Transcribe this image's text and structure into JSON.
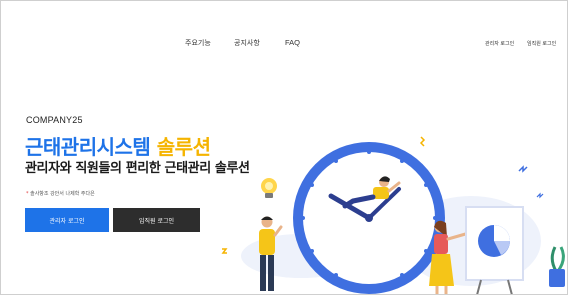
{
  "nav": {
    "items": [
      "주요기능",
      "공지사항",
      "FAQ"
    ],
    "admin_login": "관리자 로그인",
    "staff_login": "임직원 로그인"
  },
  "hero": {
    "brand": "COMPANY25",
    "title_main": "근태관리시스템",
    "title_accent": "솔루션",
    "subtitle": "관리자와 직원들의 편리한 근태관리 솔루션",
    "note_marker": "*",
    "note": "솔사항조 강안서 나제학 주다은",
    "admin_button": "관리자 로그인",
    "staff_button": "임직원 로그인"
  },
  "colors": {
    "primary": "#1e73e8",
    "accent": "#f5b400",
    "dark_button": "#2d2d2d",
    "clock_blue": "#3f6fe0"
  },
  "icons": [
    "clock-illustration",
    "lightbulb-icon",
    "chart-board-icon",
    "plant-icon"
  ]
}
